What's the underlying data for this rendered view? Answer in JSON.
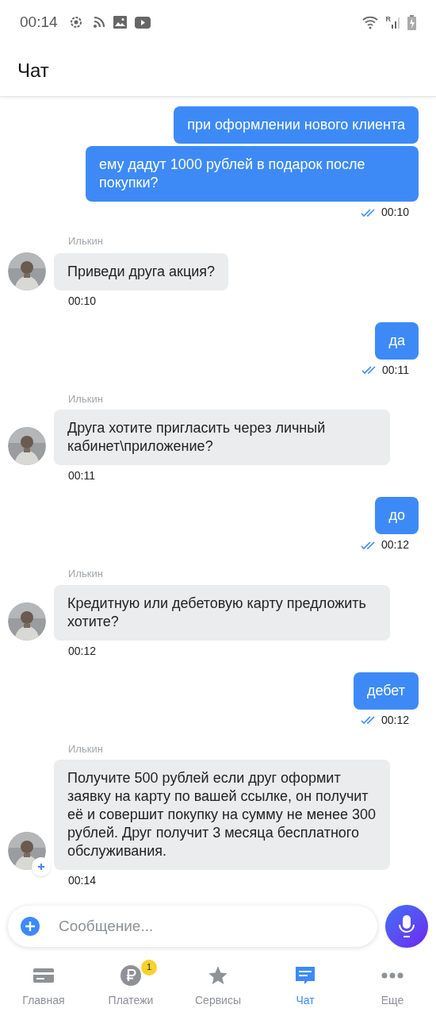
{
  "status_bar": {
    "time": "00:14",
    "roaming": "R"
  },
  "header": {
    "title": "Чат"
  },
  "messages": [
    {
      "kind": "out",
      "bubbles": [
        "при оформлении нового клиента",
        "ему дадут 1000 рублей в подарок после покупки?"
      ],
      "time": "00:10",
      "read": true
    },
    {
      "kind": "in",
      "sender": "Илькин",
      "text": "Приведи друга акция?",
      "time": "00:10",
      "badge": false
    },
    {
      "kind": "out",
      "bubbles": [
        "да"
      ],
      "time": "00:11",
      "read": true
    },
    {
      "kind": "in",
      "sender": "Илькин",
      "text": "Друга хотите пригласить через личный кабинет\\приложение?",
      "time": "00:11",
      "badge": false
    },
    {
      "kind": "out",
      "bubbles": [
        "до"
      ],
      "time": "00:12",
      "read": true
    },
    {
      "kind": "in",
      "sender": "Илькин",
      "text": "Кредитную или дебетовую карту предложить хотите?",
      "time": "00:12",
      "badge": false
    },
    {
      "kind": "out",
      "bubbles": [
        "дебет"
      ],
      "time": "00:12",
      "read": true
    },
    {
      "kind": "in",
      "sender": "Илькин",
      "text": "Получите 500 рублей если друг оформит заявку на карту по вашей ссылке, он получит её и совершит покупку на сумму не менее 300 рублей. Друг получит 3 месяца бесплатного обслуживания.",
      "time": "00:14",
      "badge": true
    }
  ],
  "composer": {
    "placeholder": "Сообщение..."
  },
  "nav": [
    {
      "kind": "card",
      "label": "Главная",
      "selected": false
    },
    {
      "kind": "ruble",
      "label": "Платежи",
      "selected": false,
      "badge": "1"
    },
    {
      "kind": "star",
      "label": "Сервисы",
      "selected": false
    },
    {
      "kind": "chat",
      "label": "Чат",
      "selected": true
    },
    {
      "kind": "more",
      "label": "Еще",
      "selected": false
    }
  ]
}
